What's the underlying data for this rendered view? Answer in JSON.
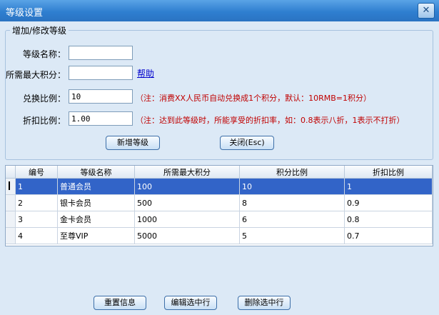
{
  "window": {
    "title": "等级设置",
    "close_glyph": "✕"
  },
  "group": {
    "legend": "增加/修改等级"
  },
  "form": {
    "name_label": "等级名称：",
    "name_value": "",
    "points_label": "所需最大积分：",
    "points_value": "",
    "help_link": "帮助",
    "ratio_label": "兑换比例：",
    "ratio_value": "10",
    "ratio_note": "（注：消费XX人民币自动兑换成1个积分，默认：10RMB=1积分）",
    "discount_label": "折扣比例：",
    "discount_value": "1.00",
    "discount_note": "（注：达到此等级时，所能享受的折扣率，如：0.8表示八折，1表示不打折）"
  },
  "buttons": {
    "add": "新增等级",
    "close": "关闭(Esc)"
  },
  "table": {
    "columns": [
      "编号",
      "等级名称",
      "所需最大积分",
      "积分比例",
      "折扣比例"
    ],
    "rows": [
      [
        "1",
        "普通会员",
        "100",
        "10",
        "1"
      ],
      [
        "2",
        "银卡会员",
        "500",
        "8",
        "0.9"
      ],
      [
        "3",
        "金卡会员",
        "1000",
        "6",
        "0.8"
      ],
      [
        "4",
        "至尊VIP",
        "5000",
        "5",
        "0.7"
      ]
    ],
    "selected_row": 0
  },
  "footer": {
    "reset": "重置信息",
    "edit": "编辑选中行",
    "delete": "删除选中行"
  },
  "colors": {
    "title_bar": "#2f7fd0",
    "selection": "#3264c8",
    "note": "#c00000"
  }
}
